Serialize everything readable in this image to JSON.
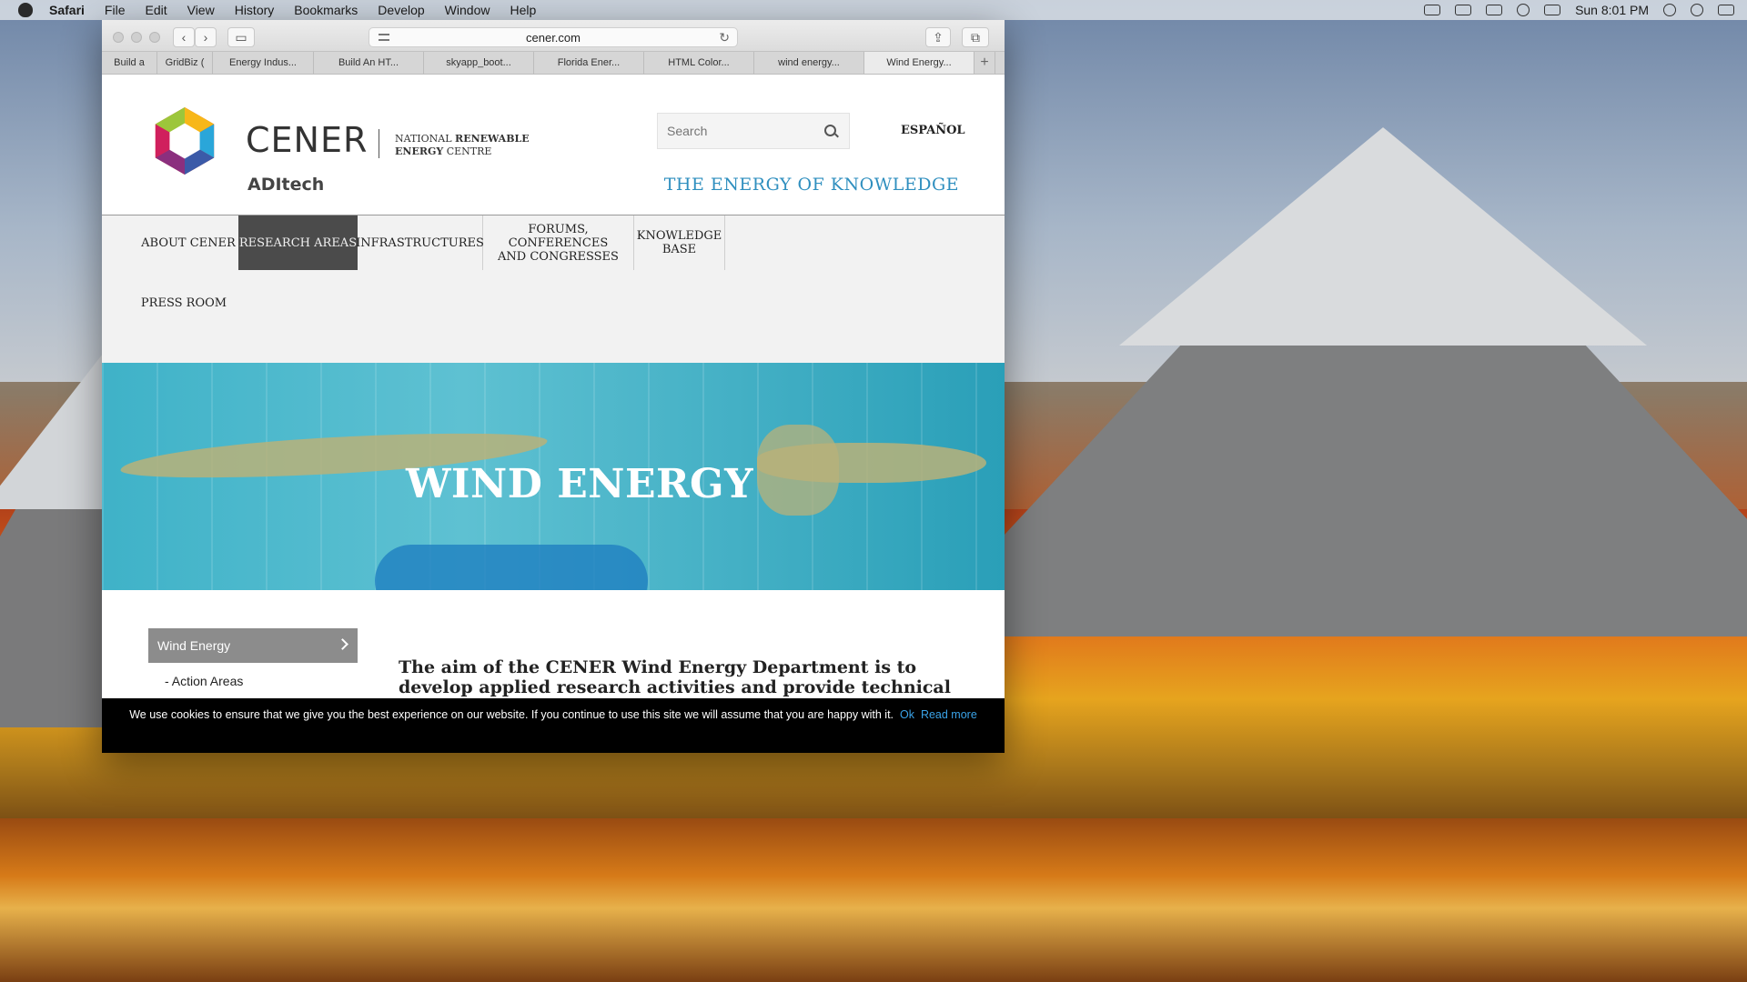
{
  "menubar": {
    "app": "Safari",
    "items": [
      "File",
      "Edit",
      "View",
      "History",
      "Bookmarks",
      "Develop",
      "Window",
      "Help"
    ],
    "clock": "Sun 8:01 PM"
  },
  "browser": {
    "url": "cener.com",
    "tabs": [
      "Build a",
      "GridBiz (",
      "Energy Indus...",
      "Build An HT...",
      "skyapp_boot...",
      "Florida Ener...",
      "HTML Color...",
      "wind energy...",
      "Wind Energy..."
    ],
    "add_tab": "+"
  },
  "site": {
    "logo_name": "CENER",
    "logo_sub": "ADItech",
    "tagline_line1_a": "NATIONAL ",
    "tagline_line1_b": "RENEWABLE",
    "tagline_line2_a": "ENERGY",
    "tagline_line2_b": " CENTRE",
    "search_placeholder": "Search",
    "language_link": "ESPAÑOL",
    "slogan": "THE ENERGY OF KNOWLEDGE",
    "nav": [
      {
        "label": "ABOUT CENER"
      },
      {
        "label": "RESEARCH AREAS",
        "active": true
      },
      {
        "label": "INFRASTRUCTURES"
      },
      {
        "label": "FORUMS, CONFERENCES AND CONGRESSES"
      },
      {
        "label": "KNOWLEDGE BASE"
      },
      {
        "label": "PRESS ROOM"
      }
    ],
    "hero_title": "WIND ENERGY",
    "side_nav_active": "Wind Energy",
    "side_nav_sub": "Action Areas",
    "lead_text": "The aim of the CENER Wind Energy Department is to develop applied research activities and provide technical advice in the"
  },
  "cookie": {
    "message": "We use cookies to ensure that we give you the best experience on our website. If you continue to use this site we will assume that you are happy with it.",
    "ok": "Ok",
    "read_more": "Read more"
  }
}
